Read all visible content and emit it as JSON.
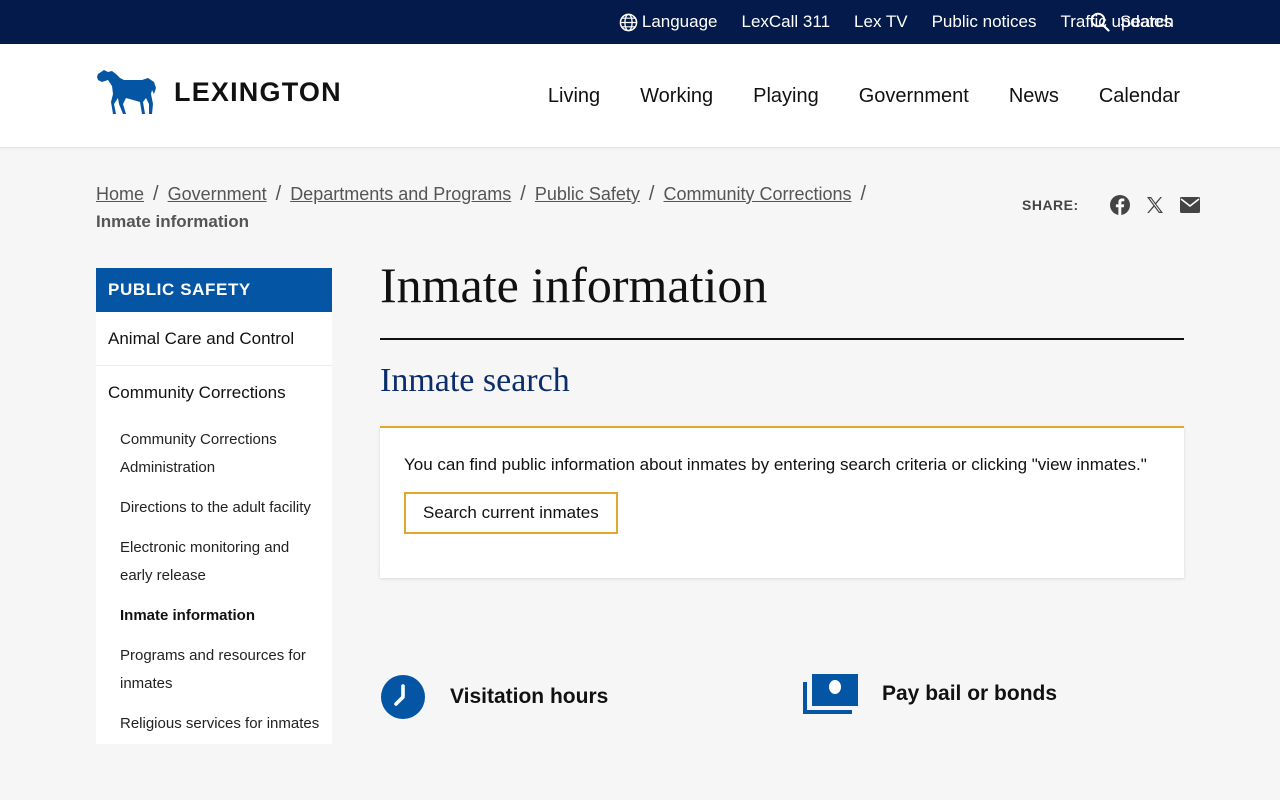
{
  "topbar": {
    "links": [
      {
        "label": "Language",
        "icon": "globe-icon"
      },
      {
        "label": "LexCall 311"
      },
      {
        "label": "Lex TV"
      },
      {
        "label": "Public notices"
      },
      {
        "label": "Traffic updates"
      }
    ],
    "search_label": "Search"
  },
  "header": {
    "logo_text": "LEXINGTON",
    "nav": [
      "Living",
      "Working",
      "Playing",
      "Government",
      "News",
      "Calendar"
    ]
  },
  "breadcrumb": {
    "items": [
      "Home",
      "Government",
      "Departments and Programs",
      "Public Safety",
      "Community Corrections"
    ],
    "separator": "/",
    "current": "Inmate information"
  },
  "share": {
    "label": "SHARE:",
    "icons": [
      "facebook-icon",
      "x-icon",
      "email-icon"
    ]
  },
  "sidebar": {
    "heading": "PUBLIC SAFETY",
    "items": [
      "Animal Care and Control",
      "Community Corrections"
    ],
    "subitems": [
      "Community Corrections Administration",
      "Directions to the adult facility",
      "Electronic monitoring and early release",
      "Inmate information",
      "Programs and resources for inmates",
      "Religious services for inmates"
    ],
    "active_subitem": "Inmate information"
  },
  "main": {
    "title": "Inmate information",
    "section_title": "Inmate search",
    "card_text": "You can find public information about inmates by entering search criteria or clicking \"view inmates.\"",
    "card_button": "Search current inmates",
    "quicklinks": [
      {
        "label": "Visitation hours",
        "icon": "clock-icon"
      },
      {
        "label": "Pay bail or bonds",
        "icon": "money-icon"
      }
    ]
  },
  "colors": {
    "topbar": "#041a4a",
    "brand_blue": "#0455a4",
    "accent_gold": "#e2a72d",
    "heading_navy": "#0c2d6b"
  }
}
